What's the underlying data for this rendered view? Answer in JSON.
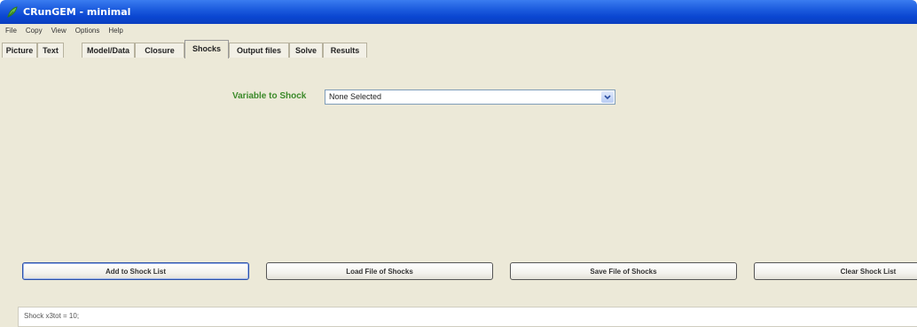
{
  "window": {
    "title": "CRunGEM - minimal"
  },
  "menu": [
    "File",
    "Copy",
    "View",
    "Options",
    "Help"
  ],
  "tabs": [
    {
      "label": "Picture"
    },
    {
      "label": "Text"
    },
    {
      "label": "Model/Data"
    },
    {
      "label": "Closure"
    },
    {
      "label": "Shocks",
      "active": true
    },
    {
      "label": "Output files"
    },
    {
      "label": "Solve"
    },
    {
      "label": "Results"
    }
  ],
  "shocks": {
    "variable_label": "Variable to Shock",
    "variable_value": "None Selected",
    "buttons": {
      "add": "Add to Shock List",
      "load": "Load File of Shocks",
      "save": "Save File of Shocks",
      "clear": "Clear Shock List"
    },
    "list": [
      "Shock x3tot = 10;"
    ]
  },
  "colors": {
    "title_bar": "#0a46d1",
    "panel_bg": "#ece9d8",
    "label_green": "#3c8a2a"
  },
  "icons": {
    "app": "green-leaf-icon",
    "dropdown": "chevron-down-icon"
  }
}
